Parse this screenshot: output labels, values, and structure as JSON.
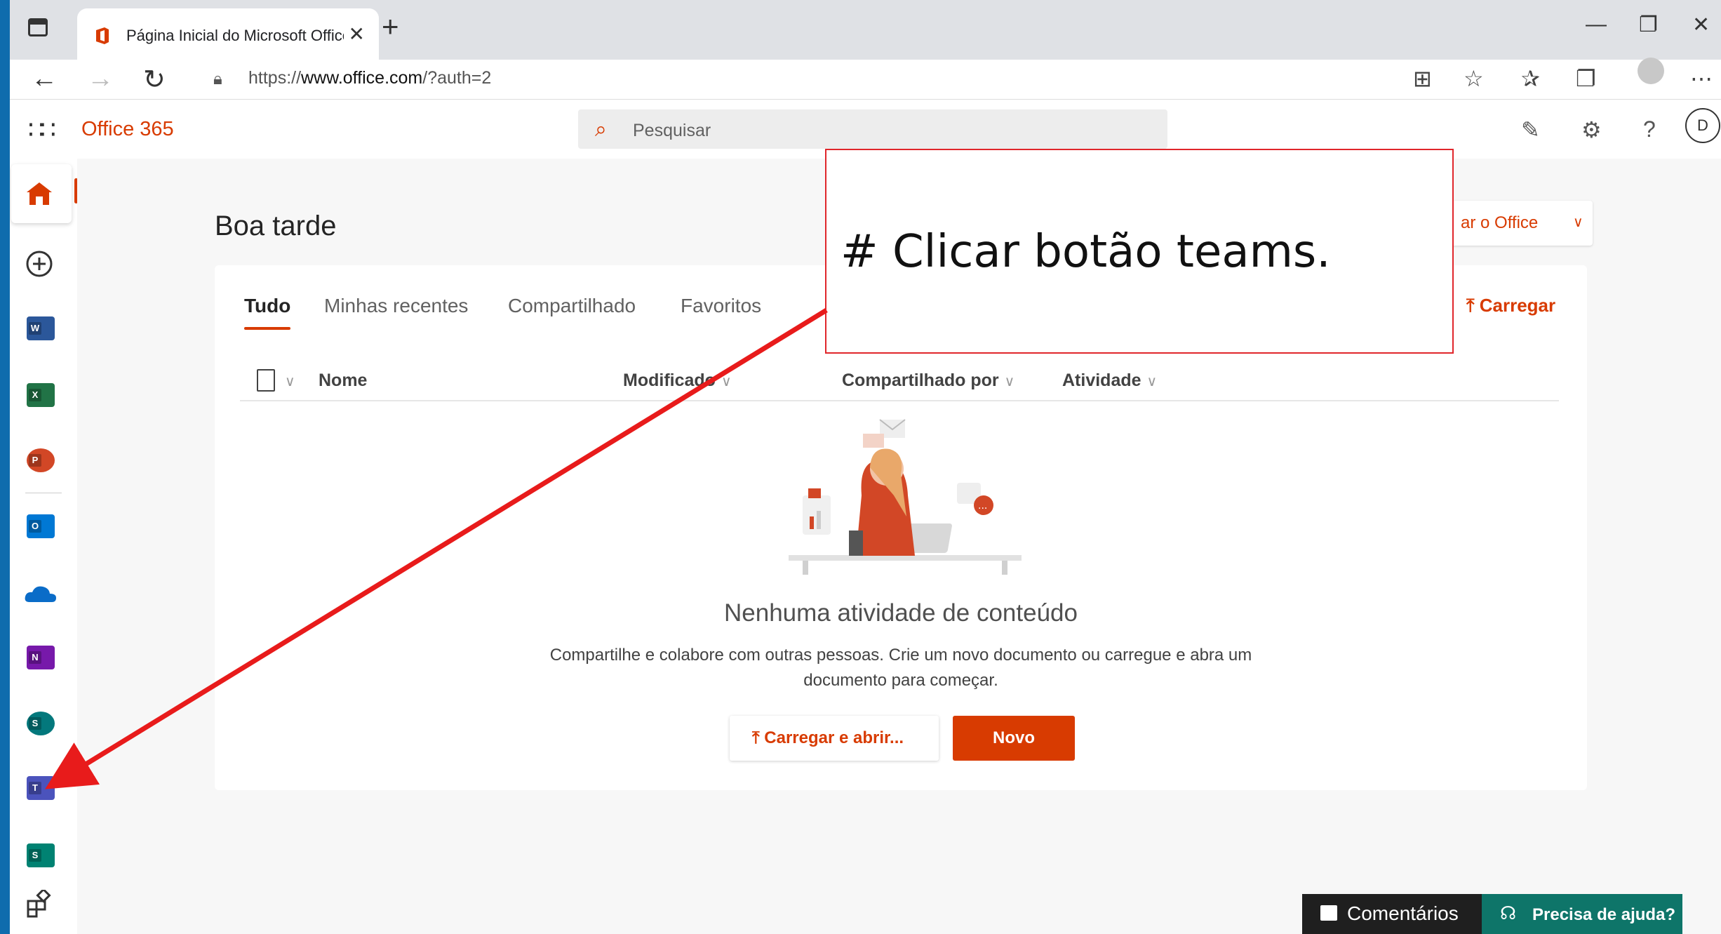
{
  "browser": {
    "tab_title": "Página Inicial do Microsoft Office",
    "tab_close": "✕",
    "new_tab": "+",
    "url_prefix": "https://",
    "url_host": "www.office.com",
    "url_path": "/?auth=2"
  },
  "suite": {
    "brand": "Office 365",
    "search_placeholder": "Pesquisar",
    "help_label": "?",
    "user_initial": "D"
  },
  "main": {
    "greeting": "Boa tarde",
    "install_label": "ar o Office",
    "tabs": [
      {
        "label": "Tudo"
      },
      {
        "label": "Minhas recentes"
      },
      {
        "label": "Compartilhado"
      },
      {
        "label": "Favoritos"
      }
    ],
    "upload_label": "Carregar",
    "columns": {
      "name": "Nome",
      "modified": "Modificado",
      "shared_by": "Compartilhado por",
      "activity": "Atividade"
    },
    "empty_title": "Nenhuma atividade de conteúdo",
    "empty_text": "Compartilhe e colabore com outras pessoas. Crie um novo documento ou carregue e abra um documento para começar.",
    "upload_open_label": "Carregar e abrir...",
    "new_label": "Novo"
  },
  "annotation": {
    "text": "# Clicar botão teams."
  },
  "footer": {
    "feedback_label": "Comentários",
    "help_label": "Precisa de ajuda?"
  },
  "apps": [
    {
      "name": "Word",
      "letter": "W",
      "color": "#2b579a"
    },
    {
      "name": "Excel",
      "letter": "X",
      "color": "#217346"
    },
    {
      "name": "PowerPoint",
      "letter": "P",
      "color": "#d24726"
    },
    {
      "name": "Outlook",
      "letter": "O",
      "color": "#0078d4"
    },
    {
      "name": "OneDrive",
      "letter": "",
      "color": "#0a6cc8"
    },
    {
      "name": "OneNote",
      "letter": "N",
      "color": "#7719aa"
    },
    {
      "name": "SharePoint",
      "letter": "S",
      "color": "#03787c"
    },
    {
      "name": "Teams",
      "letter": "T",
      "color": "#4b53bc"
    },
    {
      "name": "Sway",
      "letter": "S",
      "color": "#008272"
    }
  ],
  "colors": {
    "accent": "#d83b01",
    "annotation_border": "#e0262b",
    "arrow": "#e81b1b",
    "help_bg": "#0e7569",
    "outer_bg": "#0f6cad"
  }
}
